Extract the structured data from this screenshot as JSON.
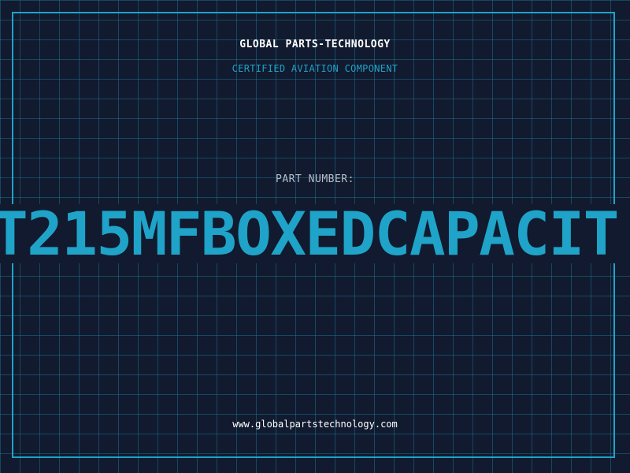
{
  "header": {
    "brand": "GLOBAL PARTS-TECHNOLOGY",
    "subtitle": "CERTIFIED AVIATION COMPONENT"
  },
  "part": {
    "label": "PART NUMBER:",
    "value": "T215MFBOXEDCAPACIT"
  },
  "footer": {
    "url": "www.globalpartstechnology.com"
  },
  "colors": {
    "background": "#111a2e",
    "accent": "#1fa3c8",
    "grid": "#1e6e8c",
    "label": "#b7bcc6",
    "text": "#ffffff"
  }
}
